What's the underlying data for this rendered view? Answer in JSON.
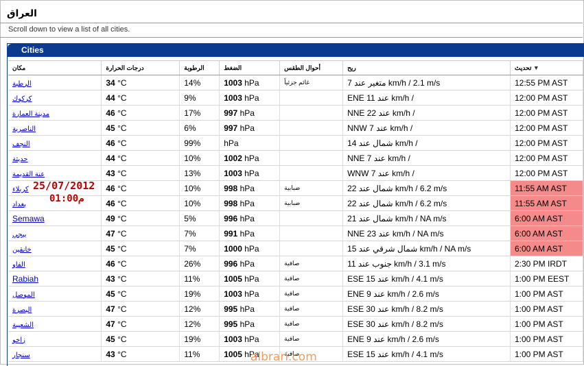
{
  "page": {
    "title": "العراق",
    "subtitle": "Scroll down to view a list of all cities.",
    "panel_title": "Cities"
  },
  "headers": {
    "city": "مكان",
    "temp": "درجات الحرارة",
    "humidity": "الرطوبة",
    "pressure": "الضغط",
    "conditions": "أحوال الطقس",
    "wind": "ريح",
    "updated": "تحديث",
    "sort_arrow": "▼"
  },
  "rows": [
    {
      "city": "الرطبة",
      "latin": false,
      "temp": "34",
      "temp_unit": "°C",
      "hum": "14%",
      "pres": "1003",
      "pres_unit": "hPa",
      "cond": "غائم جزئياً",
      "wind": "7 متغير عند km/h / 2.1 m/s",
      "updated": "12:55 PM AST",
      "hl": false
    },
    {
      "city": "كركوك",
      "latin": false,
      "temp": "44",
      "temp_unit": "°C",
      "hum": "9%",
      "pres": "1003",
      "pres_unit": "hPa",
      "cond": "",
      "wind": "ENE 11 عند km/h /",
      "updated": "12:00 PM AST",
      "hl": false
    },
    {
      "city": "مدينة العمارة",
      "latin": false,
      "temp": "46",
      "temp_unit": "°C",
      "hum": "17%",
      "pres": "997",
      "pres_unit": "hPa",
      "cond": "",
      "wind": "NNE 22 عند km/h /",
      "updated": "12:00 PM AST",
      "hl": false
    },
    {
      "city": "الناصرية",
      "latin": false,
      "temp": "45",
      "temp_unit": "°C",
      "hum": "6%",
      "pres": "997",
      "pres_unit": "hPa",
      "cond": "",
      "wind": "NNW 7 عند km/h /",
      "updated": "12:00 PM AST",
      "hl": false
    },
    {
      "city": "النجف",
      "latin": false,
      "temp": "46",
      "temp_unit": "°C",
      "hum": "99%",
      "pres": "",
      "pres_unit": "hPa",
      "cond": "",
      "wind": "14 شمال عند km/h /",
      "updated": "12:00 PM AST",
      "hl": false
    },
    {
      "city": "حديثة",
      "latin": false,
      "temp": "44",
      "temp_unit": "°C",
      "hum": "10%",
      "pres": "1002",
      "pres_unit": "hPa",
      "cond": "",
      "wind": "NNE 7 عند km/h /",
      "updated": "12:00 PM AST",
      "hl": false
    },
    {
      "city": "عنة القديمة",
      "latin": false,
      "temp": "43",
      "temp_unit": "°C",
      "hum": "13%",
      "pres": "1003",
      "pres_unit": "hPa",
      "cond": "",
      "wind": "WNW 7 عند km/h /",
      "updated": "12:00 PM AST",
      "hl": false
    },
    {
      "city": "كربلاء",
      "latin": false,
      "temp": "46",
      "temp_unit": "°C",
      "hum": "10%",
      "pres": "998",
      "pres_unit": "hPa",
      "cond": "ضبابية",
      "wind": "22 شمال عند km/h / 6.2 m/s",
      "updated": "11:55 AM AST",
      "hl": true
    },
    {
      "city": "بغداد",
      "latin": false,
      "temp": "46",
      "temp_unit": "°C",
      "hum": "10%",
      "pres": "998",
      "pres_unit": "hPa",
      "cond": "ضبابية",
      "wind": "22 شمال عند km/h / 6.2 m/s",
      "updated": "11:55 AM AST",
      "hl": true
    },
    {
      "city": "Semawa",
      "latin": true,
      "temp": "49",
      "temp_unit": "°C",
      "hum": "5%",
      "pres": "996",
      "pres_unit": "hPa",
      "cond": "",
      "wind": "21 شمال عند km/h / NA m/s",
      "updated": "6:00 AM AST",
      "hl": true
    },
    {
      "city": "بيجي",
      "latin": false,
      "temp": "47",
      "temp_unit": "°C",
      "hum": "7%",
      "pres": "991",
      "pres_unit": "hPa",
      "cond": "",
      "wind": "NNE 23 عند km/h / NA m/s",
      "updated": "6:00 AM AST",
      "hl": true
    },
    {
      "city": "خانقين",
      "latin": false,
      "temp": "45",
      "temp_unit": "°C",
      "hum": "7%",
      "pres": "1000",
      "pres_unit": "hPa",
      "cond": "",
      "wind": "15 شمال شرقي عند km/h / NA m/s",
      "updated": "6:00 AM AST",
      "hl": true
    },
    {
      "city": "الفاو",
      "latin": false,
      "temp": "46",
      "temp_unit": "°C",
      "hum": "26%",
      "pres": "996",
      "pres_unit": "hPa",
      "cond": "صافية",
      "wind": "11 جنوب عند km/h / 3.1 m/s",
      "updated": "2:30 PM IRDT",
      "hl": false
    },
    {
      "city": "Rabiah",
      "latin": true,
      "temp": "43",
      "temp_unit": "°C",
      "hum": "11%",
      "pres": "1005",
      "pres_unit": "hPa",
      "cond": "صافية",
      "wind": "ESE 15 عند km/h / 4.1 m/s",
      "updated": "1:00 PM EEST",
      "hl": false
    },
    {
      "city": "الموصل",
      "latin": false,
      "temp": "45",
      "temp_unit": "°C",
      "hum": "19%",
      "pres": "1003",
      "pres_unit": "hPa",
      "cond": "صافية",
      "wind": "ENE 9 عند km/h / 2.6 m/s",
      "updated": "1:00 PM AST",
      "hl": false
    },
    {
      "city": "البصرة",
      "latin": false,
      "temp": "47",
      "temp_unit": "°C",
      "hum": "12%",
      "pres": "995",
      "pres_unit": "hPa",
      "cond": "صافية",
      "wind": "ESE 30 عند km/h / 8.2 m/s",
      "updated": "1:00 PM AST",
      "hl": false
    },
    {
      "city": "الشعيبة",
      "latin": false,
      "temp": "47",
      "temp_unit": "°C",
      "hum": "12%",
      "pres": "995",
      "pres_unit": "hPa",
      "cond": "صافية",
      "wind": "ESE 30 عند km/h / 8.2 m/s",
      "updated": "1:00 PM AST",
      "hl": false
    },
    {
      "city": "زاخو",
      "latin": false,
      "temp": "45",
      "temp_unit": "°C",
      "hum": "19%",
      "pres": "1003",
      "pres_unit": "hPa",
      "cond": "صافية",
      "wind": "ENE 9 عند km/h / 2.6 m/s",
      "updated": "1:00 PM AST",
      "hl": false
    },
    {
      "city": "سنجار",
      "latin": false,
      "temp": "43",
      "temp_unit": "°C",
      "hum": "11%",
      "pres": "1005",
      "pres_unit": "hPa",
      "cond": "صافية",
      "wind": "ESE 15 عند km/h / 4.1 m/s",
      "updated": "1:00 PM AST",
      "hl": false
    }
  ],
  "stamp": {
    "date": "25/07/2012",
    "time": "م01:00"
  },
  "watermark": "albrari.com",
  "colors": {
    "header_blue": "#0b3a8f",
    "highlight": "#f58a8a",
    "link": "#0000cc",
    "stamp": "#c00000"
  }
}
